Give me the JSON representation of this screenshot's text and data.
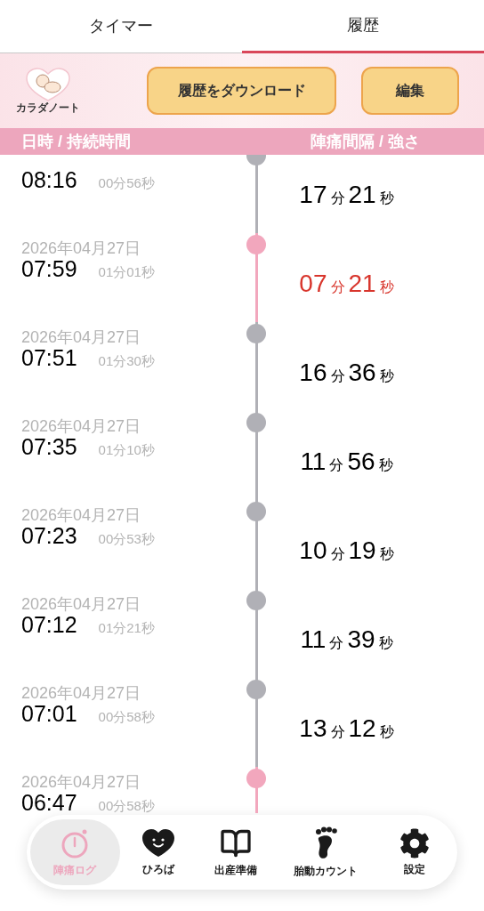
{
  "tabs": [
    {
      "label": "タイマー",
      "selected": false
    },
    {
      "label": "履歴",
      "selected": true
    }
  ],
  "header": {
    "logo_text": "カラダノート",
    "buttons": [
      "履歴をダウンロード",
      "編集"
    ]
  },
  "columns": [
    "日時 / 持続時間",
    "陣痛間隔 / 強さ"
  ],
  "entries": [
    {
      "time": "08:16",
      "duration": "00分56秒",
      "highlighted": false,
      "interval": [
        "17",
        "分",
        "21",
        "秒"
      ]
    },
    {
      "date": "2026年04月27日",
      "time": "07:59",
      "duration": "01分01秒",
      "highlighted": true,
      "interval": [
        "07",
        "分",
        "21",
        "秒"
      ]
    },
    {
      "date": "2026年04月27日",
      "time": "07:51",
      "duration": "01分30秒",
      "highlighted": false,
      "interval": [
        "16",
        "分",
        "36",
        "秒"
      ]
    },
    {
      "date": "2026年04月27日",
      "time": "07:35",
      "duration": "01分10秒",
      "highlighted": false,
      "interval": [
        "11",
        "分",
        "56",
        "秒"
      ]
    },
    {
      "date": "2026年04月27日",
      "time": "07:23",
      "duration": "00分53秒",
      "highlighted": false,
      "interval": [
        "10",
        "分",
        "19",
        "秒"
      ]
    },
    {
      "date": "2026年04月27日",
      "time": "07:12",
      "duration": "01分21秒",
      "highlighted": false,
      "interval": [
        "11",
        "分",
        "39",
        "秒"
      ]
    },
    {
      "date": "2026年04月27日",
      "time": "07:01",
      "duration": "00分58秒",
      "highlighted": false,
      "interval": [
        "13",
        "分",
        "12",
        "秒"
      ]
    },
    {
      "date": "2026年04月27日",
      "time": "06:47",
      "duration": "00分58秒",
      "highlighted": true
    }
  ],
  "nav": [
    {
      "label": "陣痛ログ",
      "kind": "timer",
      "selected": true
    },
    {
      "label": "ひろば",
      "kind": "heart",
      "selected": false
    },
    {
      "label": "出産準備",
      "kind": "book",
      "selected": false
    },
    {
      "label": "胎動カウント",
      "kind": "foot",
      "selected": false
    },
    {
      "label": "設定",
      "kind": "gear",
      "selected": false
    }
  ]
}
